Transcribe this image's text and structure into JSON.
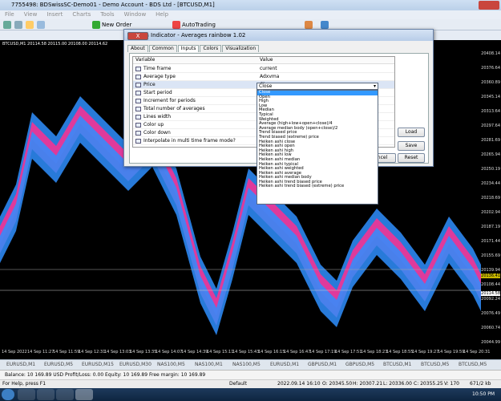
{
  "window": {
    "title": "7755498: BDSwissSC-Demo01 - Demo Account - BDS Ltd - [BTCUSD,M1]"
  },
  "menu": [
    "File",
    "View",
    "Insert",
    "Charts",
    "Tools",
    "Window",
    "Help"
  ],
  "toolbar": {
    "new_order": "New Order",
    "autotrading": "AutoTrading"
  },
  "chart": {
    "label": "BTCUSD,M1  20114.58 20115.00 20108.00 20114.62",
    "price_ticks": [
      "20408.14",
      "20376.64",
      "20360.89",
      "20345.14",
      "20313.64",
      "20297.64",
      "20281.69",
      "20265.94",
      "20250.19",
      "20234.44",
      "20218.69",
      "20202.94",
      "20187.19",
      "20171.44",
      "20155.69",
      "20139.94",
      "20108.44",
      "20092.24",
      "20076.49",
      "20060.74",
      "20044.99"
    ],
    "price_tags": [
      "20136.41",
      "20114.58"
    ],
    "time_ticks": [
      "14 Sep 2022",
      "14 Sep 11:27",
      "14 Sep 11:59",
      "14 Sep 12:31",
      "14 Sep 13:03",
      "14 Sep 13:35",
      "14 Sep 14:07",
      "14 Sep 14:39",
      "14 Sep 15:11",
      "14 Sep 15:43",
      "14 Sep 16:15",
      "14 Sep 16:47",
      "14 Sep 17:19",
      "14 Sep 17:51",
      "14 Sep 18:23",
      "14 Sep 18:55",
      "14 Sep 19:27",
      "14 Sep 19:59",
      "14 Sep 20:31"
    ],
    "colors": {
      "up": "#2f8fff",
      "down": "#ff2f8f"
    }
  },
  "symbol_tabs": [
    "EURUSD,M1",
    "EURUSD,M5",
    "EURUSD,M15",
    "EURUSD,M30",
    "NAS100,M5",
    "NAS100,M1",
    "NAS100,M5",
    "EURUSD,M1",
    "GBPUSD,M1",
    "GBPUSD,M5",
    "BTCUSD,M1",
    "BTCUSD,M5",
    "BTCUSD,M5"
  ],
  "account": {
    "text": "Balance: 10 169.89 USD  Profit/Loss: 0.00  Equity: 10 169.89  Free margin: 10 169.89"
  },
  "status": {
    "help": "For Help, press F1",
    "profile": "Default",
    "datetime": "2022.09.14 16:10",
    "open": "O: 20345.50",
    "high": "H: 20307.21",
    "low": "L: 20336.00",
    "close": "C: 20355.25",
    "volume": "V: 170",
    "traffic": "671/2 kb"
  },
  "taskbar": {
    "time": "10:50 PM"
  },
  "dialog": {
    "title": "Custom Indicator - Averages rainbow 1.02",
    "help_btn": "?",
    "close_btn": "X",
    "tabs": [
      "About",
      "Common",
      "Inputs",
      "Colors",
      "Visualization"
    ],
    "col_variable": "Variable",
    "col_value": "Value",
    "rows": [
      {
        "k": "Time frame",
        "v": "current"
      },
      {
        "k": "Average type",
        "v": "Adxvma"
      },
      {
        "k": "Price",
        "v": "Close"
      },
      {
        "k": "Start period",
        "v": ""
      },
      {
        "k": "Increment for periods",
        "v": ""
      },
      {
        "k": "Total number of averages",
        "v": ""
      },
      {
        "k": "Lines width",
        "v": ""
      },
      {
        "k": "Color up",
        "v": ""
      },
      {
        "k": "Color down",
        "v": ""
      },
      {
        "k": "Interpolate in multi time frame mode?",
        "v": ""
      }
    ],
    "load": "Load",
    "save": "Save",
    "cancel": "ncel",
    "reset": "Reset",
    "dropdown": [
      "Close",
      "Open",
      "High",
      "Low",
      "Median",
      "Typical",
      "Weighted",
      "Average (high+low+open+close)/4",
      "Average median body (open+close)/2",
      "Trend biased price",
      "Trend biased (extreme) price",
      "Heiken ashi close",
      "Heiken ashi open",
      "Heiken ashi high",
      "Heiken ashi low",
      "Heiken ashi median",
      "Heiken ashi typical",
      "Heiken ashi weighted",
      "Heiken ashi average",
      "Heiken ashi median body",
      "Heiken ashi trend biased price",
      "Heiken ashi trend biased (extreme) price"
    ]
  }
}
